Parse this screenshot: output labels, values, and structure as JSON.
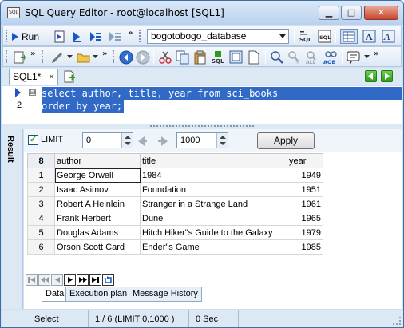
{
  "window": {
    "app_icon_text": "SQL",
    "title": "SQL Query Editor - root@localhost [SQL1]",
    "minimize_glyph": "▁",
    "maximize_glyph": "□",
    "close_glyph": "✕"
  },
  "toolbar1": {
    "run_label": "Run",
    "database_selected": "bogotobogo_database",
    "overflow_glyph": "»"
  },
  "toolbar2": {
    "overflow_glyph": "»"
  },
  "tabs": {
    "active_tab": "SQL1*",
    "close_glyph": "×"
  },
  "editor": {
    "line_numbers": [
      "1",
      "2"
    ],
    "fold_glyph": "⊟",
    "lines": [
      "select author, title, year from sci_books",
      "order by year;"
    ]
  },
  "result": {
    "side_label": "Result",
    "limit_checked": true,
    "limit_label": "LIMIT",
    "limit_offset": "0",
    "limit_count": "1000",
    "apply_label": "Apply",
    "columns": [
      "author",
      "title",
      "year"
    ],
    "index_header": "8",
    "rows": [
      {
        "idx": "1",
        "author": "George Orwell",
        "title": "1984",
        "year": "1949"
      },
      {
        "idx": "2",
        "author": "Isaac Asimov",
        "title": "Foundation",
        "year": "1951"
      },
      {
        "idx": "3",
        "author": "Robert A Heinlein",
        "title": "Stranger in a Strange Land",
        "year": "1961"
      },
      {
        "idx": "4",
        "author": "Frank Herbert",
        "title": "Dune",
        "year": "1965"
      },
      {
        "idx": "5",
        "author": "Douglas Adams",
        "title": "Hitch Hiker\"s Guide to the Galaxy",
        "year": "1979"
      },
      {
        "idx": "6",
        "author": "Orson Scott Card",
        "title": "Ender\"s Game",
        "year": "1985"
      }
    ],
    "bottom_tabs": [
      "Data",
      "Execution plan",
      "Message History"
    ]
  },
  "status": {
    "mode": "Select",
    "rows_info": "1 / 6 (LIMIT 0,1000 )",
    "time": "0 Sec"
  },
  "colors": {
    "selection": "#3169c6",
    "titlebar": "#b9d1ee",
    "accent_green": "#2d9a1b"
  }
}
